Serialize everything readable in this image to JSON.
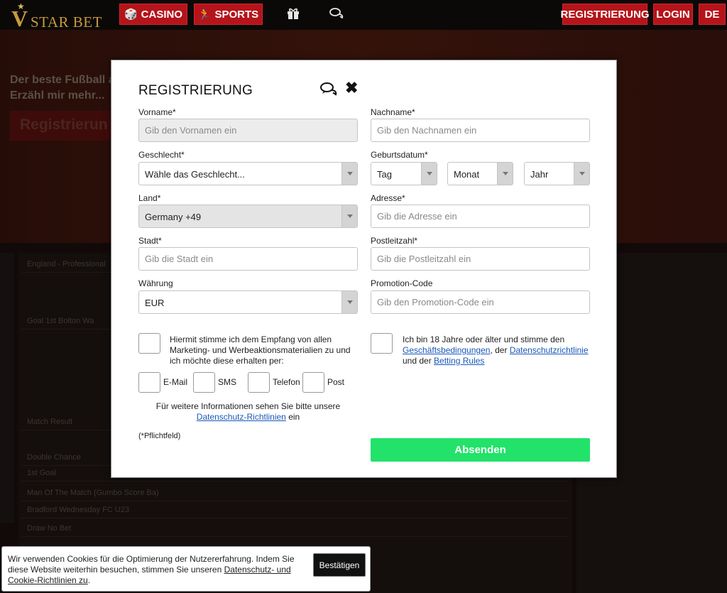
{
  "header": {
    "logo_text": "STAR BET",
    "logo_letter": "V",
    "casino_label": "CASINO",
    "sports_label": "SPORTS",
    "register_label": "REGISTRIERUNG",
    "login_label": "LOGIN",
    "language_label": "DE",
    "icons": [
      "gift-icon",
      "chat-icon"
    ]
  },
  "background": {
    "hero_sub1": "Der beste Fußball au",
    "hero_sub2": "Erzähl mir mehr...",
    "hero_button": "Registrierun",
    "rows": [
      "England - Professional",
      "Goal 1st Bolton Wa",
      "Match Result",
      "Double Chance",
      "1st Goal",
      "Man Of The Match (Gumbo Score Ba)",
      "Bradford Wednesday FC U23",
      "Draw No Bet"
    ]
  },
  "modal": {
    "title": "REGISTRIERUNG",
    "fields": {
      "vorname_label": "Vorname*",
      "vorname_placeholder": "Gib den Vornamen ein",
      "nachname_label": "Nachname*",
      "nachname_placeholder": "Gib den Nachnamen ein",
      "geschlecht_label": "Geschlecht*",
      "geschlecht_value": "Wähle das Geschlecht...",
      "geburtsdatum_label": "Geburtsdatum*",
      "tag_value": "Tag",
      "monat_value": "Monat",
      "jahr_value": "Jahr",
      "land_label": "Land*",
      "land_value": "Germany +49",
      "adresse_label": "Adresse*",
      "adresse_placeholder": "Gib die Adresse ein",
      "stadt_label": "Stadt*",
      "stadt_placeholder": "Gib die Stadt ein",
      "plz_label": "Postleitzahl*",
      "plz_placeholder": "Gib die Postleitzahl ein",
      "waehrung_label": "Währung",
      "waehrung_value": "EUR",
      "promo_label": "Promotion-Code",
      "promo_placeholder": "Gib den Promotion-Code ein"
    },
    "marketing_text": "Hiermit stimme ich dem Empfang von allen Marketing- und Werbeaktionsmaterialien zu und ich möchte diese erhalten per:",
    "channels": {
      "email": "E-Mail",
      "sms": "SMS",
      "telefon": "Telefon",
      "post": "Post"
    },
    "info_text": "Für weitere Informationen sehen Sie bitte unsere",
    "info_link": "Datenschutz-Richtlinien",
    "info_suffix": "ein",
    "required_note": "(*Pflichtfeld)",
    "terms": {
      "part1": "Ich bin 18 Jahre oder älter und stimme den",
      "link1": "Geschäftsbedingungen",
      "part2": ", der",
      "link2": "Datenschutzrichtlinie",
      "part3": "und der",
      "link3": "Betting Rules"
    },
    "submit_label": "Absenden"
  },
  "cookie": {
    "text": "Wir verwenden Cookies für die Optimierung der Nutzererfahrung. Indem Sie diese Website weiterhin besuchen, stimmen Sie unseren",
    "link": "Datenschutz- und Cookie-Richtlinien zu",
    "suffix": ".",
    "button": "Bestätigen"
  },
  "colors": {
    "brand_red": "#b5141a",
    "submit_green": "#22e26a",
    "link_blue": "#1b58b8",
    "logo_gold": "#c89a3c"
  }
}
